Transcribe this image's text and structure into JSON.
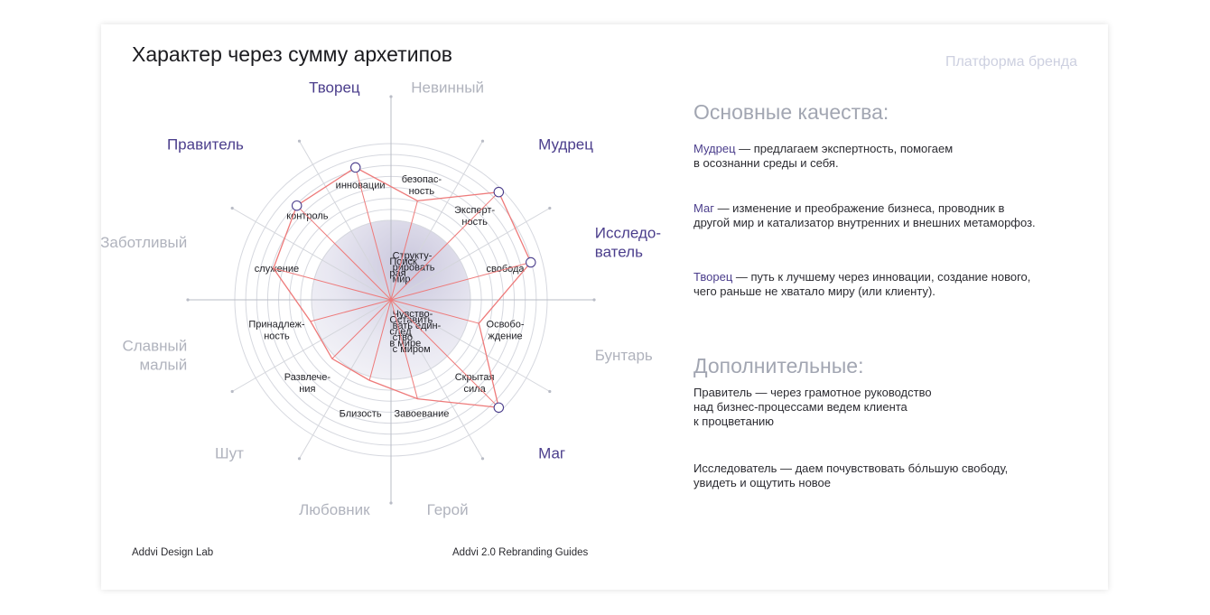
{
  "header": {
    "title": "Характер через сумму архетипов",
    "section": "Платформа бренда"
  },
  "wheel": {
    "archetypes": [
      {
        "label": "Невинный",
        "accent": false
      },
      {
        "label": "Мудрец",
        "accent": true
      },
      {
        "label": "Исследо-\nватель",
        "accent": true
      },
      {
        "label": "Бунтарь",
        "accent": false
      },
      {
        "label": "Маг",
        "accent": true
      },
      {
        "label": "Герой",
        "accent": false
      },
      {
        "label": "Любовник",
        "accent": false
      },
      {
        "label": "Шут",
        "accent": false
      },
      {
        "label": "Славный\nмалый",
        "accent": false
      },
      {
        "label": "Заботливый",
        "accent": false
      },
      {
        "label": "Правитель",
        "accent": true
      },
      {
        "label": "Творец",
        "accent": true
      }
    ],
    "values": [
      {
        "label": "безопас-\nность"
      },
      {
        "label": "Эксперт-\nность"
      },
      {
        "label": "свобода"
      },
      {
        "label": "Освобо-\nждение"
      },
      {
        "label": "Скрытая\nсила"
      },
      {
        "label": "Завоевание"
      },
      {
        "label": "Близость"
      },
      {
        "label": "Развлече-\nния"
      },
      {
        "label": "Принадлеж-\nность"
      },
      {
        "label": "служение"
      },
      {
        "label": "контроль"
      },
      {
        "label": "инновации"
      }
    ],
    "motives": [
      {
        "label": "Поиск\nрая"
      },
      {
        "label": "Оставить\nслед\nв мире"
      },
      {
        "label": "Чувство-\nвать един-\nство\nс миром"
      },
      {
        "label": "Структу-\nрировать\nмир"
      }
    ],
    "profile_levels": [
      0.3,
      0.95,
      0.85,
      0.15,
      0.95,
      0.3,
      0.05,
      0.05,
      0.05,
      0.55,
      0.7,
      0.75
    ],
    "marked_archetypes": [
      "Мудрец",
      "Исследо-\nватель",
      "Маг",
      "Правитель",
      "Творец"
    ],
    "colors": {
      "accent": "#4b3e8c",
      "muted": "#b0b3bd",
      "ring": "#d6d8df",
      "line": "#ee7a7a",
      "core": "#e6e6f0"
    }
  },
  "main_qualities": {
    "heading": "Основные качества:",
    "items": [
      {
        "name": "Мудрец",
        "text": " — предлагаем экспертность, помогаем\nв осознанни среды и себя."
      },
      {
        "name": "Маг",
        "text": " — изменение и преображение бизнеса, проводник в\nдругой мир и катализатор внутренних и внешних метаморфоз."
      },
      {
        "name": "Творец",
        "text": " — путь к лучшему через инновации, создание нового,\nчего раньше не хватало миру (или клиенту)."
      }
    ]
  },
  "additional": {
    "heading": "Дополнительные:",
    "items": [
      {
        "text": "Правитель — через грамотное руководство\nнад бизнес-процессами ведем клиента\nк процветанию"
      },
      {
        "text": "Исследователь — даем почувствовать бóльшую свободу,\nувидеть и ощутить новое"
      }
    ]
  },
  "footer": {
    "left": "Addvi Design Lab",
    "center": "Addvi 2.0 Rebranding Guides"
  }
}
